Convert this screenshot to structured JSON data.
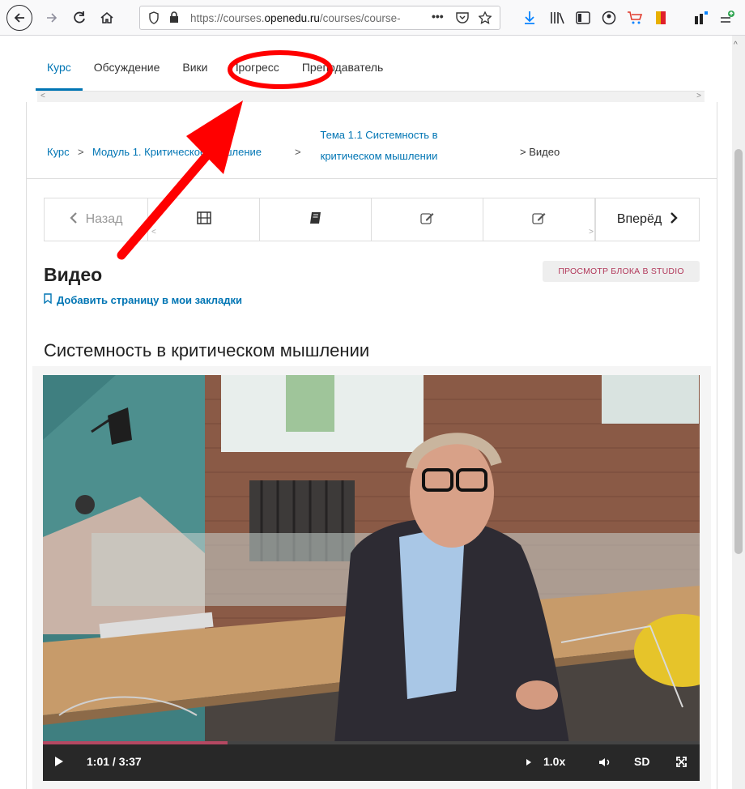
{
  "browser": {
    "url_prefix": "https://courses.",
    "url_domain": "openedu.ru",
    "url_suffix": "/courses/course-",
    "more_glyph": "•••"
  },
  "course_tabs": [
    "Курс",
    "Обсуждение",
    "Вики",
    "Прогресс",
    "Преподаватель"
  ],
  "breadcrumb": {
    "course": "Курс",
    "module": "Модуль 1. Критическое мышление",
    "topic": "Тема 1.1 Системность в критическом мышлении",
    "current": "Видео"
  },
  "sequence_nav": {
    "prev_label": "Назад",
    "next_label": "Вперёд"
  },
  "block": {
    "title": "Видео",
    "studio_button": "ПРОСМОТР БЛОКА В STUDIO",
    "bookmark_label": "Добавить страницу в мои закладки"
  },
  "video": {
    "title": "Системность в критическом мышлении",
    "time": "1:01 / 3:37",
    "progress_fraction": 0.281,
    "speed": "1.0x",
    "quality": "SD"
  },
  "colors": {
    "link": "#0075b4",
    "studio_text": "#b2395b",
    "annotation": "#ff0000",
    "progress": "#b54862"
  }
}
